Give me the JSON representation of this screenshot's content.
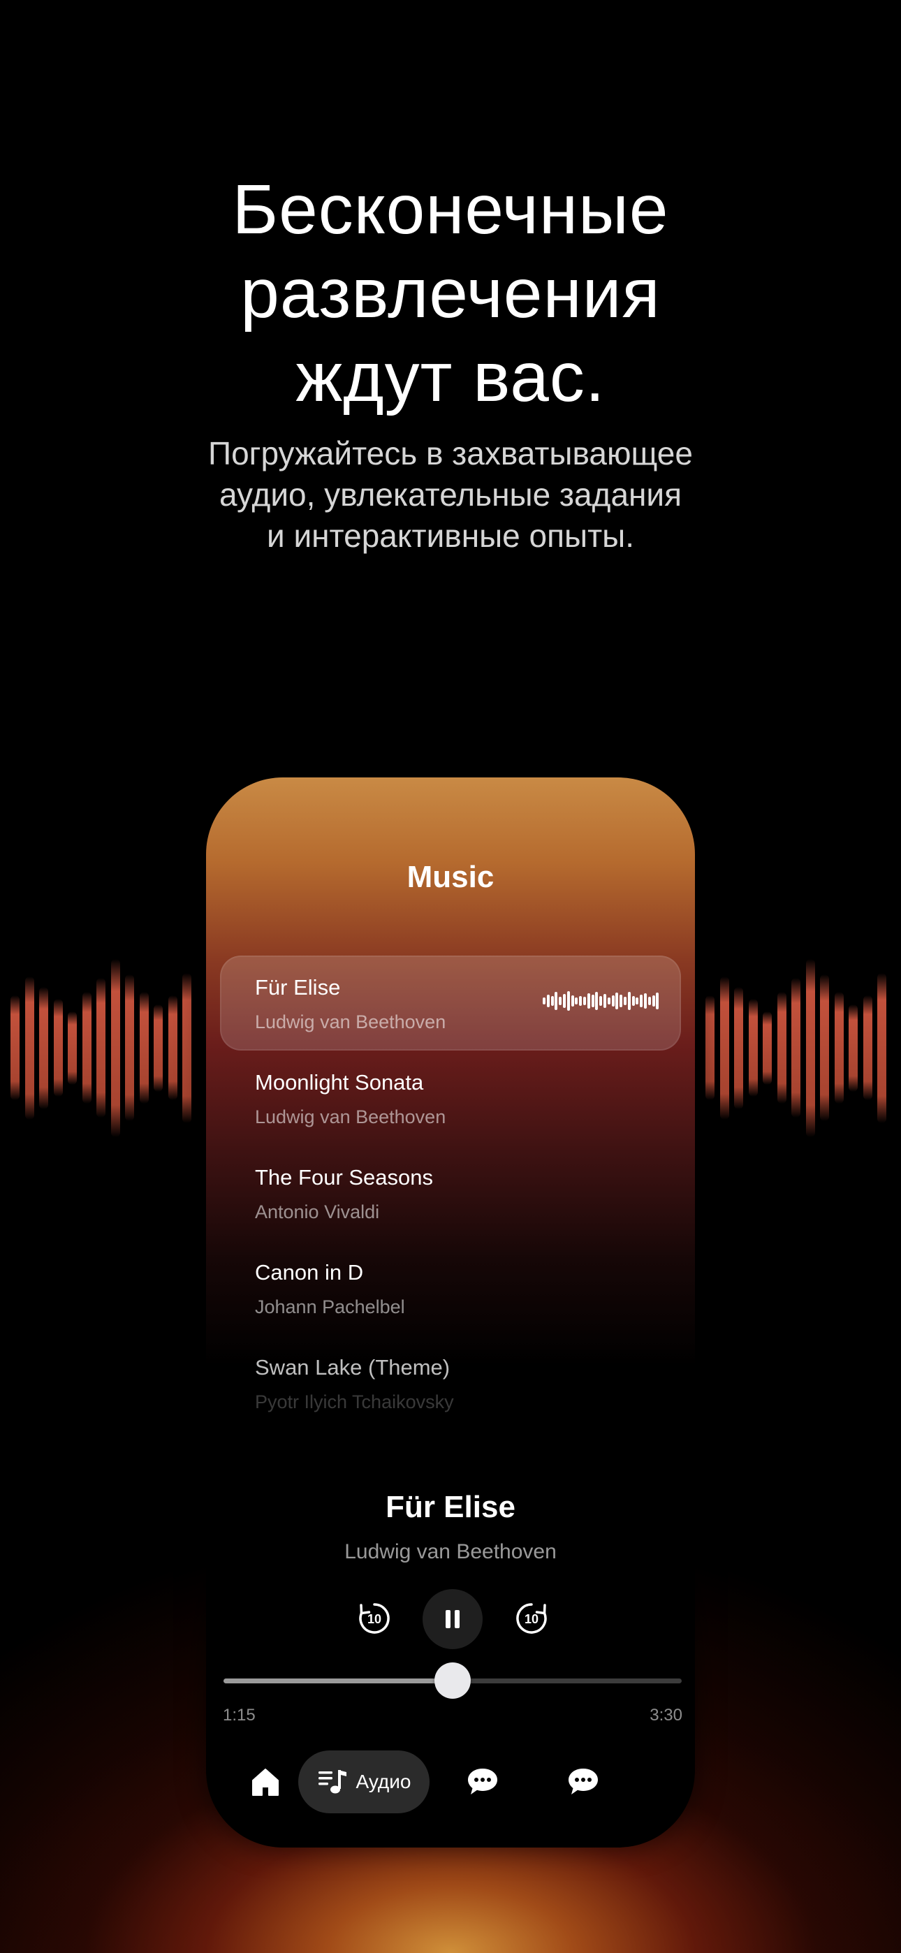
{
  "promo": {
    "headline": "Бесконечные\nразвлечения\nждут вас.",
    "subline": "Погружайтесь в захватывающее\nаудио, увлекательные задания\nи интерактивные опыты."
  },
  "app": {
    "title": "Music",
    "tracks": [
      {
        "title": "Für Elise",
        "artist": "Ludwig van Beethoven",
        "active": true
      },
      {
        "title": "Moonlight Sonata",
        "artist": "Ludwig van Beethoven",
        "active": false
      },
      {
        "title": "The Four Seasons",
        "artist": "Antonio Vivaldi",
        "active": false
      },
      {
        "title": "Canon in D",
        "artist": "Johann Pachelbel",
        "active": false
      },
      {
        "title": "Swan Lake (Theme)",
        "artist": "Pyotr Ilyich Tchaikovsky",
        "active": false
      }
    ],
    "now_playing": {
      "title": "Für Elise",
      "artist": "Ludwig van Beethoven",
      "elapsed": "1:15",
      "duration": "3:30",
      "progress_fraction": 0.5,
      "skip_back_label": "10",
      "skip_forward_label": "10"
    },
    "tabbar": {
      "audio_label": "Аудио",
      "active_tab": "audio",
      "icons": [
        "home-icon",
        "audio-list-icon",
        "chat-bubble-icon",
        "chat-bubble-icon"
      ]
    }
  },
  "colors": {
    "background": "#000000",
    "glow": "#d6963c",
    "equalizer": "#e45f46",
    "phone_top": "#c98a45"
  }
}
